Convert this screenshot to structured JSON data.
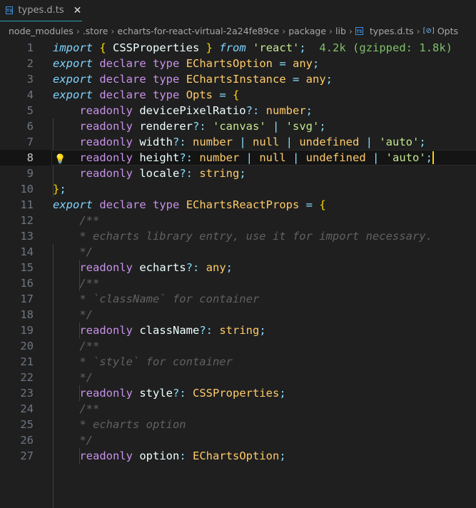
{
  "tab": {
    "icon": "TS",
    "label": "types.d.ts"
  },
  "breadcrumbs": [
    "node_modules",
    ".store",
    "echarts-for-react-virtual-2a24fe89ce",
    "package",
    "lib",
    "types.d.ts",
    "Opts"
  ],
  "active_line": 8,
  "lines": [
    [
      [
        "import",
        "kw"
      ],
      [
        " "
      ],
      [
        "{",
        "br"
      ],
      [
        " CSSProperties ",
        "pr"
      ],
      [
        "}",
        "br"
      ],
      [
        " "
      ],
      [
        "from",
        "kw"
      ],
      [
        " "
      ],
      [
        "'react'",
        "str"
      ],
      [
        ";",
        "pu"
      ],
      [
        "  4.2k (gzipped: 1.8k)",
        "hint"
      ]
    ],
    [
      [
        "export",
        "kw"
      ],
      [
        " "
      ],
      [
        "declare",
        "st"
      ],
      [
        " "
      ],
      [
        "type",
        "st"
      ],
      [
        " "
      ],
      [
        "EChartsOption",
        "ty"
      ],
      [
        " = ",
        "pu"
      ],
      [
        "any",
        "ty"
      ],
      [
        ";",
        "pu"
      ]
    ],
    [
      [
        "export",
        "kw"
      ],
      [
        " "
      ],
      [
        "declare",
        "st"
      ],
      [
        " "
      ],
      [
        "type",
        "st"
      ],
      [
        " "
      ],
      [
        "EChartsInstance",
        "ty"
      ],
      [
        " = ",
        "pu"
      ],
      [
        "any",
        "ty"
      ],
      [
        ";",
        "pu"
      ]
    ],
    [
      [
        "export",
        "kw"
      ],
      [
        " "
      ],
      [
        "declare",
        "st"
      ],
      [
        " "
      ],
      [
        "type",
        "st"
      ],
      [
        " "
      ],
      [
        "Opts",
        "ty"
      ],
      [
        " = ",
        "pu"
      ],
      [
        "{",
        "br"
      ]
    ],
    [
      [
        "    "
      ],
      [
        "readonly",
        "st"
      ],
      [
        " "
      ],
      [
        "devicePixelRatio",
        "pr"
      ],
      [
        "?:",
        "pu"
      ],
      [
        " "
      ],
      [
        "number",
        "ty"
      ],
      [
        ";",
        "pu"
      ]
    ],
    [
      [
        "    "
      ],
      [
        "readonly",
        "st"
      ],
      [
        " "
      ],
      [
        "renderer",
        "pr"
      ],
      [
        "?:",
        "pu"
      ],
      [
        " "
      ],
      [
        "'canvas'",
        "str"
      ],
      [
        " | ",
        "pu"
      ],
      [
        "'svg'",
        "str"
      ],
      [
        ";",
        "pu"
      ]
    ],
    [
      [
        "    "
      ],
      [
        "readonly",
        "st"
      ],
      [
        " "
      ],
      [
        "width",
        "pr"
      ],
      [
        "?:",
        "pu"
      ],
      [
        " "
      ],
      [
        "number",
        "ty"
      ],
      [
        " | ",
        "pu"
      ],
      [
        "null",
        "ty"
      ],
      [
        " | ",
        "pu"
      ],
      [
        "undefined",
        "ty"
      ],
      [
        " | ",
        "pu"
      ],
      [
        "'auto'",
        "str"
      ],
      [
        ";",
        "pu"
      ]
    ],
    [
      [
        "    "
      ],
      [
        "readonly",
        "st"
      ],
      [
        " "
      ],
      [
        "height",
        "pr"
      ],
      [
        "?:",
        "pu"
      ],
      [
        " "
      ],
      [
        "number",
        "ty"
      ],
      [
        " | ",
        "pu"
      ],
      [
        "null",
        "ty"
      ],
      [
        " | ",
        "pu"
      ],
      [
        "undefined",
        "ty"
      ],
      [
        " | ",
        "pu"
      ],
      [
        "'auto'",
        "str"
      ],
      [
        ";",
        "pu caret"
      ]
    ],
    [
      [
        "    "
      ],
      [
        "readonly",
        "st"
      ],
      [
        " "
      ],
      [
        "locale",
        "pr"
      ],
      [
        "?:",
        "pu"
      ],
      [
        " "
      ],
      [
        "string",
        "ty"
      ],
      [
        ";",
        "pu"
      ]
    ],
    [
      [
        "}",
        "br"
      ],
      [
        ";",
        "pu"
      ]
    ],
    [
      [
        "export",
        "kw"
      ],
      [
        " "
      ],
      [
        "declare",
        "st"
      ],
      [
        " "
      ],
      [
        "type",
        "st"
      ],
      [
        " "
      ],
      [
        "EChartsReactProps",
        "ty"
      ],
      [
        " = ",
        "pu"
      ],
      [
        "{",
        "br"
      ]
    ],
    [
      [
        "    "
      ],
      [
        "/**",
        "cm"
      ]
    ],
    [
      [
        "    "
      ],
      [
        "* echarts library entry, use it for import necessary.",
        "cm"
      ]
    ],
    [
      [
        "    "
      ],
      [
        "*/",
        "cm"
      ]
    ],
    [
      [
        "    "
      ],
      [
        "readonly",
        "st"
      ],
      [
        " "
      ],
      [
        "echarts",
        "pr"
      ],
      [
        "?:",
        "pu"
      ],
      [
        " "
      ],
      [
        "any",
        "ty"
      ],
      [
        ";",
        "pu"
      ]
    ],
    [
      [
        "    "
      ],
      [
        "/**",
        "cm"
      ]
    ],
    [
      [
        "    "
      ],
      [
        "* `className` for container",
        "cm"
      ]
    ],
    [
      [
        "    "
      ],
      [
        "*/",
        "cm"
      ]
    ],
    [
      [
        "    "
      ],
      [
        "readonly",
        "st"
      ],
      [
        " "
      ],
      [
        "className",
        "pr"
      ],
      [
        "?:",
        "pu"
      ],
      [
        " "
      ],
      [
        "string",
        "ty"
      ],
      [
        ";",
        "pu"
      ]
    ],
    [
      [
        "    "
      ],
      [
        "/**",
        "cm"
      ]
    ],
    [
      [
        "    "
      ],
      [
        "* `style` for container",
        "cm"
      ]
    ],
    [
      [
        "    "
      ],
      [
        "*/",
        "cm"
      ]
    ],
    [
      [
        "    "
      ],
      [
        "readonly",
        "st"
      ],
      [
        " "
      ],
      [
        "style",
        "pr"
      ],
      [
        "?:",
        "pu"
      ],
      [
        " "
      ],
      [
        "CSSProperties",
        "ty"
      ],
      [
        ";",
        "pu"
      ]
    ],
    [
      [
        "    "
      ],
      [
        "/**",
        "cm"
      ]
    ],
    [
      [
        "    "
      ],
      [
        "* echarts option",
        "cm"
      ]
    ],
    [
      [
        "    "
      ],
      [
        "*/",
        "cm"
      ]
    ],
    [
      [
        "    "
      ],
      [
        "readonly",
        "st"
      ],
      [
        " "
      ],
      [
        "option",
        "pr"
      ],
      [
        ":",
        "pu"
      ],
      [
        " "
      ],
      [
        "EChartsOption",
        "ty"
      ],
      [
        ";",
        "pu"
      ]
    ]
  ]
}
